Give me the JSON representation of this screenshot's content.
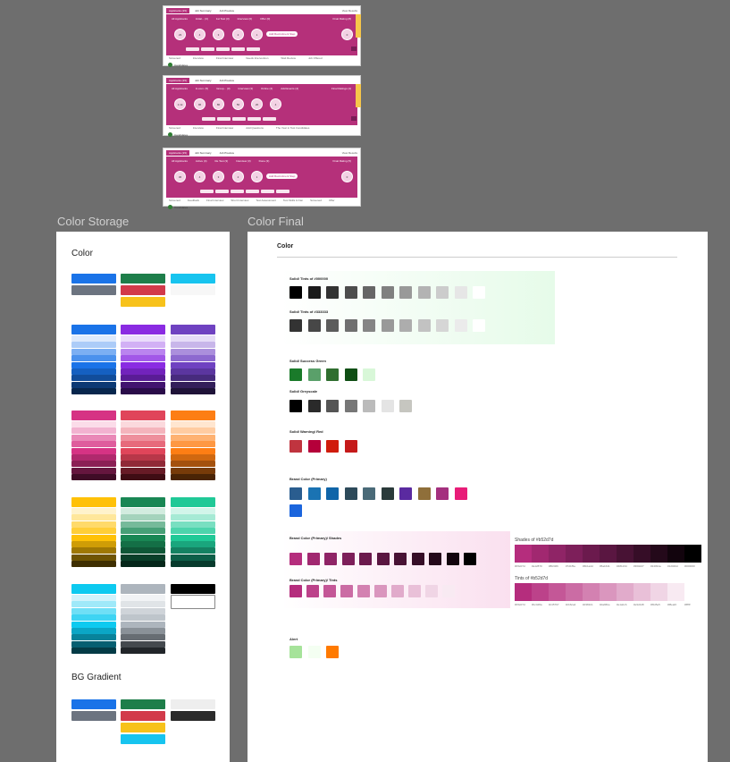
{
  "thumbnails": [
    {
      "tabs": [
        "Applicants (15)",
        "Job Summary",
        "Job Preview"
      ],
      "right": "View Results",
      "headers": [
        "All Applicants",
        "Initial... (3)",
        "1st Test (3)",
        "Interview (0)",
        "Offer (0)"
      ],
      "right_header": "Final Rating (8)",
      "nodes": [
        "23",
        "4",
        "3",
        "2",
        "1",
        "0"
      ],
      "button": "Add Recruitment Step",
      "stages": [
        "Screened",
        "Interview",
        "Final Interview",
        "Needs Intervention",
        "Wait Review",
        "Job Offered"
      ],
      "foot": "Candidates"
    },
    {
      "tabs": [
        "Applicants (15)",
        "Job Summary",
        "Job Preview"
      ],
      "right": "",
      "headers": [
        "All Applicants",
        "In.com. (5)",
        "Group... (3)",
        "Interview (3)",
        "Online (4)",
        "Add Events (4)"
      ],
      "right_header": "Final Ratings (4)",
      "nodes": [
        "1.1k",
        "96",
        "80",
        "50",
        "20",
        "4"
      ],
      "button": "",
      "stages": [
        "Screened",
        "Interview",
        "Final Interview",
        "Add Questions",
        "The Year in Test Candidates"
      ],
      "foot": "Candidates"
    },
    {
      "tabs": [
        "Applicants (15)",
        "Job Summary",
        "Job Preview"
      ],
      "right": "View Results",
      "headers": [
        "All Applicants",
        "Active (4)",
        "Re Test (3)",
        "Interview (3)",
        "Done (3)"
      ],
      "right_header": "Final Rating (5)",
      "nodes": [
        "36",
        "4",
        "3",
        "2",
        "1",
        "0"
      ],
      "button": "Add Recruitment Step",
      "stages": [
        "Screened",
        "Feedback",
        "Final Interview",
        "Short Interview",
        "Test Assessment",
        "Test Skills & Fan",
        "Screened",
        "Offer"
      ],
      "foot": "Candidates"
    }
  ],
  "storage": {
    "section_title": "Color Storage",
    "heading": "Color",
    "gradient_heading": "BG Gradient"
  },
  "final": {
    "section_title": "Color Final",
    "heading": "Color",
    "groups": {
      "tints_black": "Solid/ Tints of #000000",
      "tints_333": "Solid/ Tints of #333333",
      "success": "Solid/ Success Green",
      "greyscale": "Solid/ Greyscale",
      "warning": "Solid/ Warning/ Red",
      "brand": "Brand Color (Primary)",
      "brand_shades": "Brand Color (Primary)/ Shades",
      "brand_tints": "Brand Color (Primary)/ Tints",
      "alert": "Alert"
    },
    "shades_title": "Shades of #b52d7d",
    "tints_title": "Tints of #b52d7d",
    "shade_hex": [
      "#b52d7d",
      "#a12870",
      "#8f2466",
      "#7d1f5a",
      "#6b1a4d",
      "#5a1641",
      "#481234",
      "#360d27",
      "#24091a",
      "#12040d",
      "#000000"
    ],
    "tint_hex": [
      "#b52d7d",
      "#bc428a",
      "#c45797",
      "#cb6ca4",
      "#d381b1",
      "#da96be",
      "#e1abcb",
      "#e9c0d8",
      "#f0d5e5",
      "#f8eaf2",
      "#ffffff"
    ]
  },
  "colors": {
    "brand": "#b5307a",
    "grey": "#6e6e6e",
    "green_tint": "#e6fbe9",
    "pink_tint": "#fae0ef"
  }
}
